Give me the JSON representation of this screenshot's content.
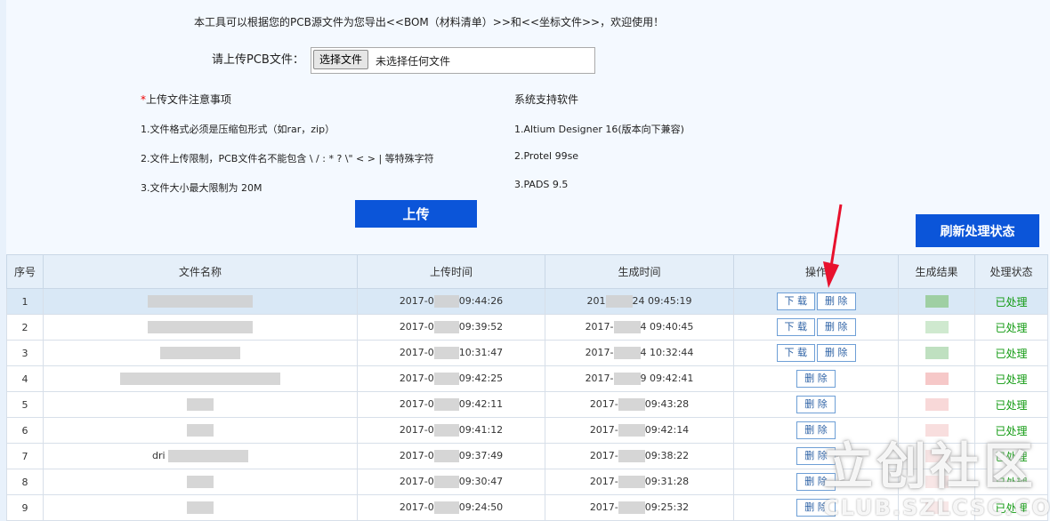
{
  "intro": "本工具可以根据您的PCB源文件为您导出<<BOM（材料清单）>>和<<坐标文件>>，欢迎使用！",
  "upload": {
    "label": "请上传PCB文件：",
    "choose_button": "选择文件",
    "file_status": "未选择任何文件",
    "submit_button": "上传"
  },
  "notes": {
    "star": "*",
    "title": "上传文件注意事项",
    "items": [
      "1.文件格式必须是压缩包形式（如rar，zip）",
      "2.文件上传限制，PCB文件名不能包含 \\ / : * ? \\\" < > | 等特殊字符",
      "3.文件大小最大限制为 20M"
    ]
  },
  "support": {
    "title": "系统支持软件",
    "items": [
      "1.Altium Designer 16(版本向下兼容)",
      "2.Protel 99se",
      "3.PADS 9.5"
    ]
  },
  "refresh_button": "刷新处理状态",
  "table": {
    "headers": [
      "序号",
      "文件名称",
      "上传时间",
      "生成时间",
      "操作",
      "生成结果",
      "处理状态"
    ],
    "download_label": "下 载",
    "delete_label": "删 除",
    "rows": [
      {
        "no": "1",
        "name": "",
        "upload_a": "2017-0",
        "upload_b": "09:44:26",
        "gen_a": "201",
        "gen_b": "24 09:45:19",
        "download": true,
        "status": "已处理",
        "result_color": "#9fcfa3"
      },
      {
        "no": "2",
        "name": "",
        "upload_a": "2017-0",
        "upload_b": "09:39:52",
        "gen_a": "2017-",
        "gen_b": "4 09:40:45",
        "download": true,
        "status": "已处理",
        "result_color": "#cfe9cf"
      },
      {
        "no": "3",
        "name": "",
        "upload_a": "2017-0",
        "upload_b": "10:31:47",
        "gen_a": "2017-",
        "gen_b": "4 10:32:44",
        "download": true,
        "status": "已处理",
        "result_color": "#bfe0c0"
      },
      {
        "no": "4",
        "name": "",
        "upload_a": "2017-0",
        "upload_b": "09:42:25",
        "gen_a": "2017-",
        "gen_b": "9 09:42:41",
        "download": false,
        "status": "已处理",
        "result_color": "#f6c8c8"
      },
      {
        "no": "5",
        "name": "",
        "upload_a": "2017-0",
        "upload_b": "09:42:11",
        "gen_a": "2017-",
        "gen_b": "09:43:28",
        "download": false,
        "status": "已处理",
        "result_color": "#f8d8d8"
      },
      {
        "no": "6",
        "name": "",
        "upload_a": "2017-0",
        "upload_b": "09:41:12",
        "gen_a": "2017-",
        "gen_b": "09:42:14",
        "download": false,
        "status": "已处理",
        "result_color": "#f8dede"
      },
      {
        "no": "7",
        "name": "dri",
        "upload_a": "2017-0",
        "upload_b": "09:37:49",
        "gen_a": "2017-",
        "gen_b": "09:38:22",
        "download": false,
        "status": "已处理",
        "result_color": "#f8e4e4"
      },
      {
        "no": "8",
        "name": "",
        "upload_a": "2017-0",
        "upload_b": "09:30:47",
        "gen_a": "2017-",
        "gen_b": "09:31:28",
        "download": false,
        "status": "已处理",
        "result_color": "#f8e6e6"
      },
      {
        "no": "9",
        "name": "",
        "upload_a": "2017-0",
        "upload_b": "09:24:50",
        "gen_a": "2017-",
        "gen_b": "09:25:32",
        "download": false,
        "status": "已处理",
        "result_color": "#f8e8e8"
      }
    ]
  },
  "watermark": {
    "main": "立创社区",
    "sub": "CLUB.SZLCSC.COM"
  },
  "colors": {
    "primary": "#0b55d9",
    "status_ok": "#119a11",
    "arrow": "#e8112d"
  }
}
